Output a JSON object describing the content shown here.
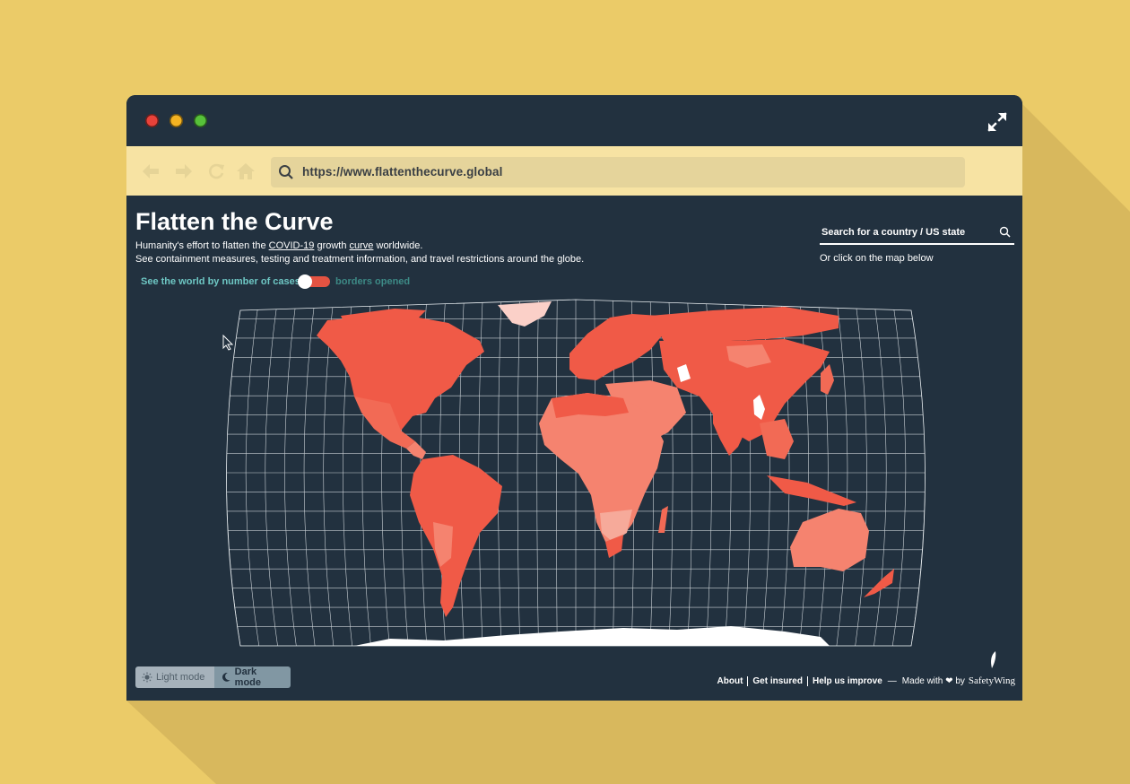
{
  "page": {
    "background_color": "#ebcb68",
    "shadow_color": "#d8b85d"
  },
  "browser": {
    "window_controls": [
      "close",
      "minimize",
      "zoom"
    ],
    "expand_icon": "expand-arrows-icon",
    "nav_icons": [
      "back-arrow-icon",
      "forward-arrow-icon",
      "reload-icon",
      "home-icon"
    ],
    "url": "https://www.flattenthecurve.global"
  },
  "site": {
    "title": "Flatten the Curve",
    "subtitle_line1": {
      "pre": "Humanity's effort to flatten the ",
      "link1": "COVID-19",
      "mid": " growth ",
      "link2": "curve",
      "post": " worldwide."
    },
    "subtitle_line2": "See containment measures, testing and treatment information, and travel restrictions around the globe.",
    "toggle": {
      "left_label": "See the world by number of cases",
      "right_label": "borders opened",
      "state": "on"
    },
    "search": {
      "placeholder": "Search for a country / US state",
      "hint": "Or click on the map below"
    },
    "map": {
      "projection": "Robinson-like graticule",
      "colors": [
        "#f05a47",
        "#f5836f",
        "#f6aa9a",
        "#fbd0c8",
        "#ffffff"
      ]
    },
    "modes": {
      "light_label": "Light mode",
      "dark_label": "Dark mode",
      "selected": "dark"
    },
    "footer": {
      "links": [
        "About",
        "Get insured",
        "Help us improve"
      ],
      "made_with": "Made with",
      "heart": "❤",
      "by": "by",
      "brand": "SafetyWing"
    }
  },
  "colors": {
    "window": "#22313f",
    "toolbar": "#f7e3a3",
    "urlbar": "#e5d49b",
    "accent_teal": "#6ec7c4",
    "accent_red": "#e45342"
  }
}
